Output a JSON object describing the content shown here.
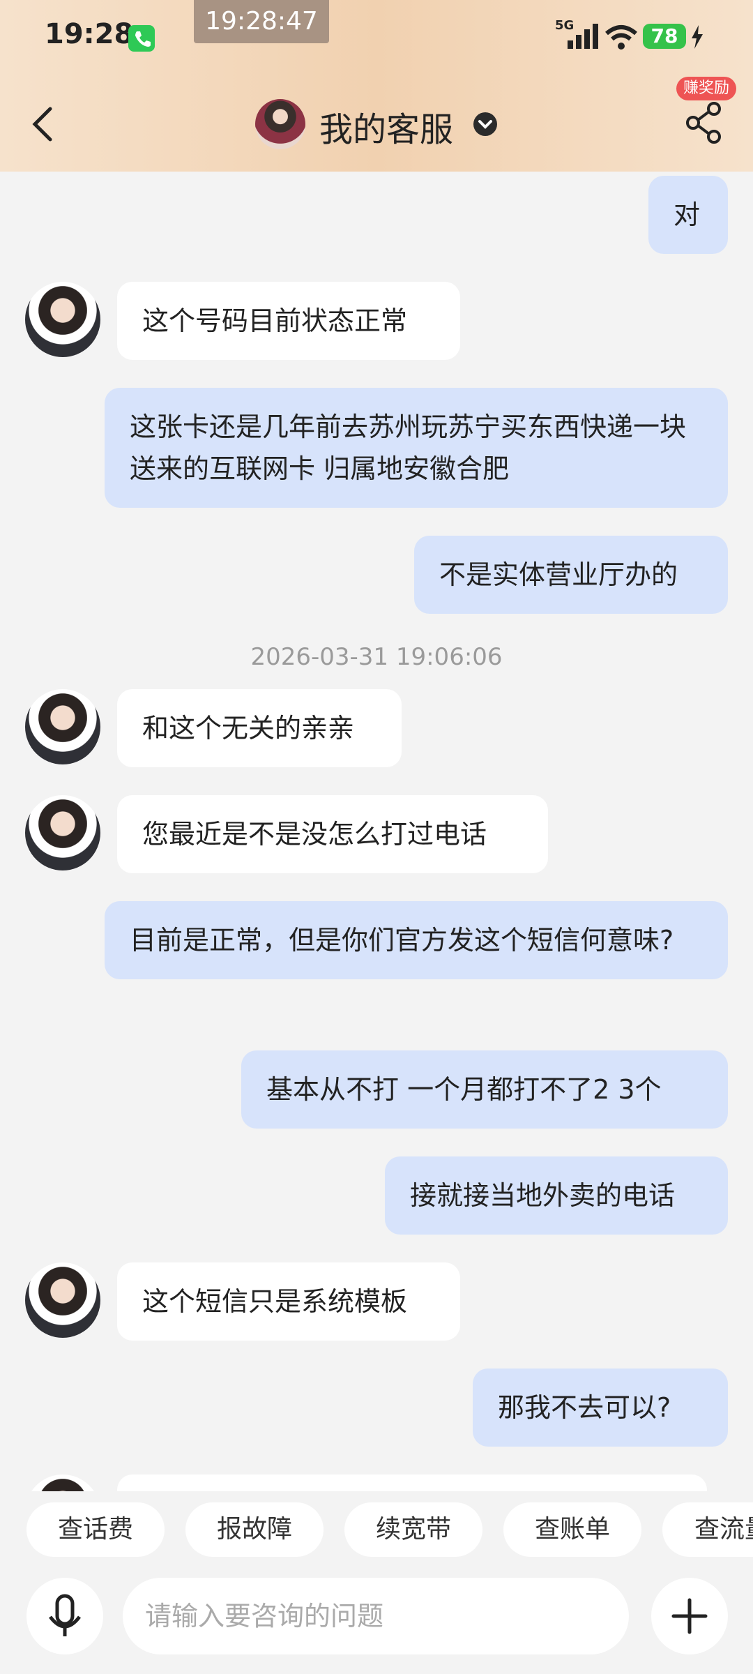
{
  "status_bar": {
    "time": "19:28",
    "recording_time": "19:28:47",
    "network": "5G",
    "battery": "78"
  },
  "header": {
    "title": "我的客服",
    "reward_badge": "赚奖励"
  },
  "messages": [
    {
      "side": "right",
      "text": "对"
    },
    {
      "side": "left",
      "text": "这个号码目前状态正常"
    },
    {
      "side": "right",
      "text": "这张卡还是几年前去苏州玩苏宁买东西快递一块送来的互联网卡  归属地安徽合肥"
    },
    {
      "side": "right",
      "text": "不是实体营业厅办的"
    },
    {
      "side": "left",
      "text": "和这个无关的亲亲"
    },
    {
      "side": "left",
      "text": "您最近是不是没怎么打过电话"
    },
    {
      "side": "right",
      "text": "目前是正常，但是你们官方发这个短信何意味?"
    },
    {
      "side": "right",
      "text": "基本从不打 一个月都打不了2 3个"
    },
    {
      "side": "right",
      "text": "接就接当地外卖的电话"
    },
    {
      "side": "left",
      "text": "这个短信只是系统模板"
    },
    {
      "side": "right",
      "text": "那我不去可以?"
    }
  ],
  "timestamp": "2026-03-31 19:06:06",
  "quick_actions": [
    "查话费",
    "报故障",
    "续宽带",
    "查账单",
    "查流量"
  ],
  "input": {
    "placeholder": "请输入要咨询的问题"
  },
  "colors": {
    "header_bg": "#f1d1b0",
    "user_bubble": "#d7e3fb",
    "agent_bubble": "#ffffff",
    "badge": "#ee5454"
  }
}
